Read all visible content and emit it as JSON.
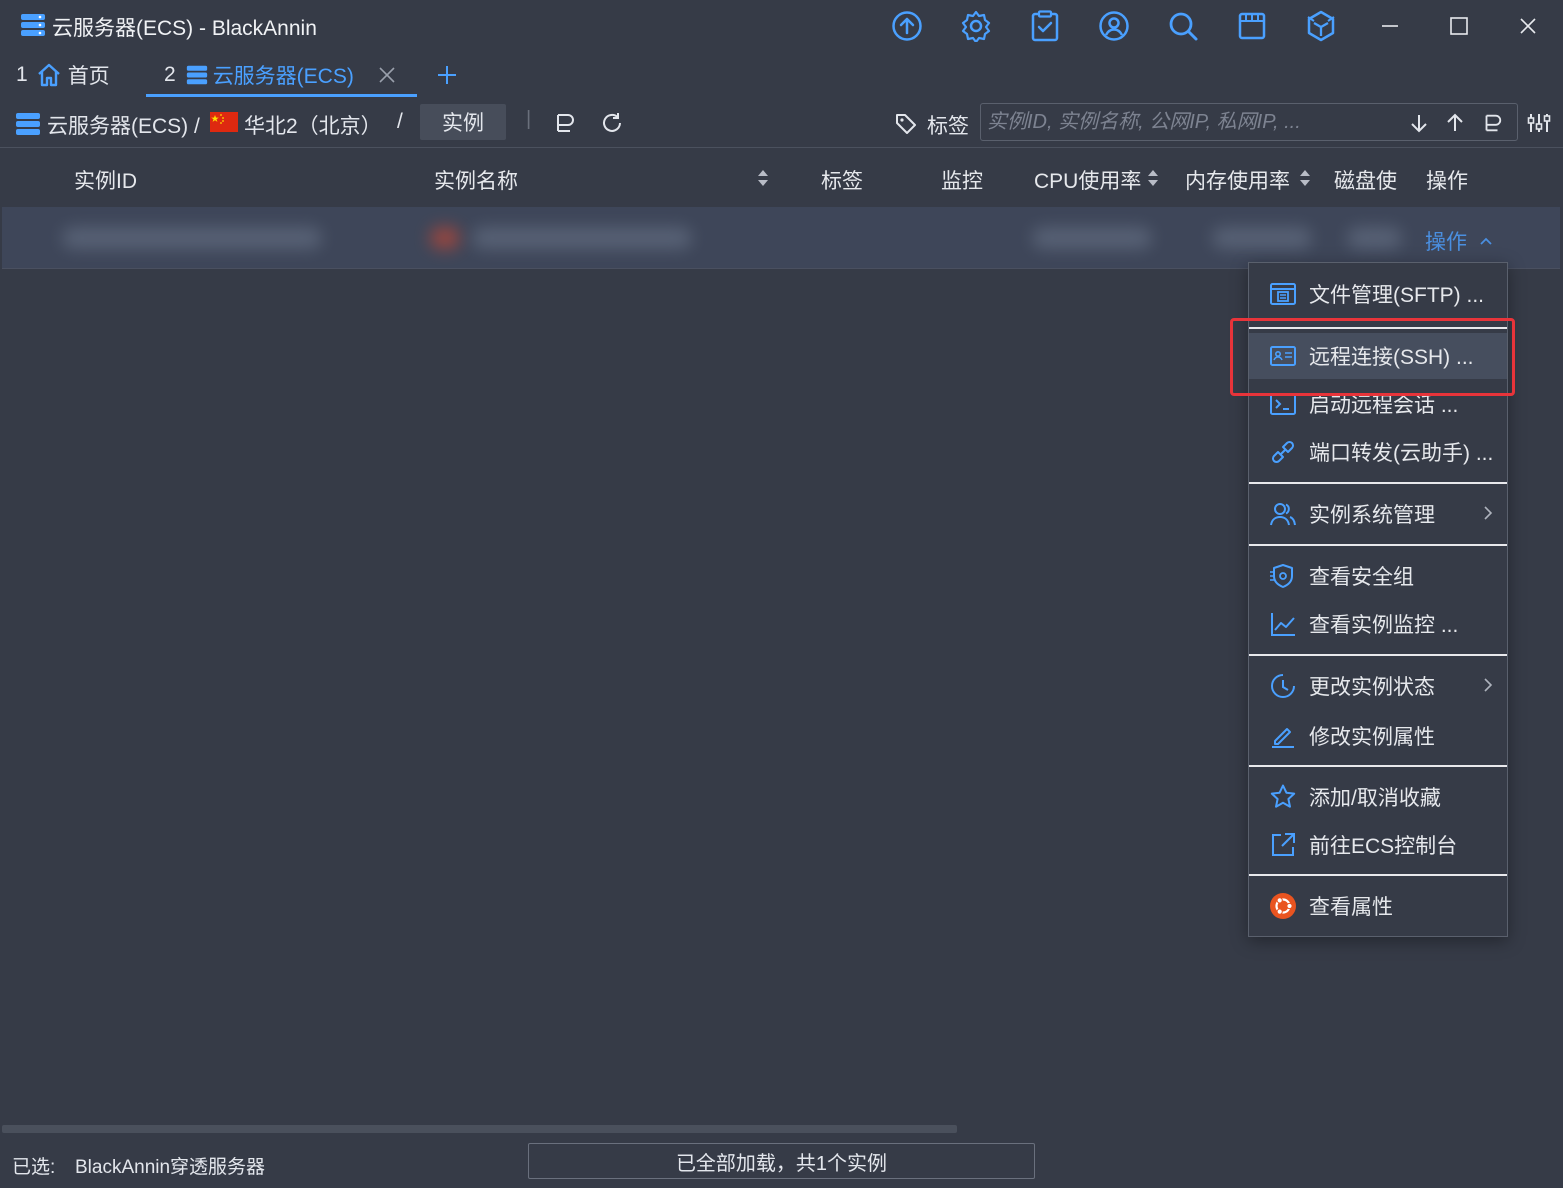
{
  "window": {
    "title": "云服务器(ECS)  - BlackAnnin",
    "toolbar_icons": [
      "upload-icon",
      "gear-icon",
      "clipboard-check-icon",
      "user-circle-icon",
      "search-icon",
      "window-icon",
      "plugin-icon"
    ],
    "controls": [
      "minimize-icon",
      "maximize-icon",
      "close-icon"
    ]
  },
  "tabs": [
    {
      "index": "1",
      "label": "首页",
      "icon": "home-icon",
      "active": false
    },
    {
      "index": "2",
      "label": "云服务器(ECS)",
      "icon": "server-icon",
      "active": true
    }
  ],
  "breadcrumb": {
    "service": "云服务器(ECS) /",
    "region": "华北2（北京）",
    "sep": "/",
    "current": "实例"
  },
  "toolbar": {
    "divider": "|",
    "tag_label": "标签",
    "search_placeholder": "实例ID, 实例名称, 公网IP, 私网IP, ..."
  },
  "table": {
    "columns": [
      "实例ID",
      "实例名称",
      "标签",
      "监控",
      "CPU使用率",
      "内存使用率",
      "磁盘使",
      "操作"
    ],
    "row_action": "操作"
  },
  "menu": {
    "items": [
      {
        "label": "文件管理(SFTP) ...",
        "icon": "file-manager-icon"
      },
      {
        "label": "远程连接(SSH) ...",
        "icon": "remote-connect-icon"
      },
      {
        "label": "启动远程会话 ...",
        "icon": "terminal-icon"
      },
      {
        "label": "端口转发(云助手) ...",
        "icon": "port-forward-icon"
      },
      {
        "label": "实例系统管理",
        "icon": "users-icon",
        "submenu": true
      },
      {
        "label": "查看安全组",
        "icon": "security-group-icon"
      },
      {
        "label": "查看实例监控 ...",
        "icon": "chart-line-icon"
      },
      {
        "label": "更改实例状态",
        "icon": "clock-icon",
        "submenu": true
      },
      {
        "label": "修改实例属性",
        "icon": "edit-icon"
      },
      {
        "label": "添加/取消收藏",
        "icon": "star-icon"
      },
      {
        "label": "前往ECS控制台",
        "icon": "external-link-icon"
      },
      {
        "label": "查看属性",
        "icon": "ubuntu-icon"
      }
    ]
  },
  "status": {
    "selected_label": "已选:",
    "selected_value": "BlackAnnin穿透服务器",
    "summary": "已全部加载，共1个实例"
  },
  "colors": {
    "background": "#363b47",
    "accent": "#4aa0ff",
    "highlight_border": "#e8343a"
  }
}
